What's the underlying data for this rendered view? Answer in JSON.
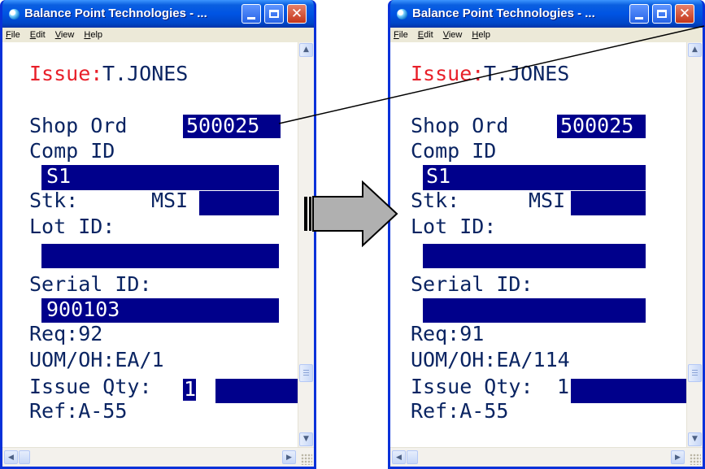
{
  "left": {
    "title": "Balance Point Technologies - ...",
    "menu": [
      "File",
      "Edit",
      "View",
      "Help"
    ],
    "screen": {
      "issue_label": "Issue:",
      "issue_user": "T.JONES",
      "shop_ord_label": "Shop Ord",
      "shop_ord_value": "500025",
      "comp_id_label": "Comp ID",
      "comp_id_value": "S1",
      "stk_label": "Stk:",
      "stk_value": "MSI",
      "lot_id_label": "Lot ID:",
      "lot_id_value": "",
      "serial_id_label": "Serial ID:",
      "serial_id_value": "900103",
      "req": "Req:92",
      "uom_oh": "UOM/OH:EA/1",
      "issue_qty_label": "Issue Qty:",
      "issue_qty_value": "1",
      "ref": "Ref:A-55"
    }
  },
  "right": {
    "title": "Balance Point Technologies - ...",
    "menu": [
      "File",
      "Edit",
      "View",
      "Help"
    ],
    "screen": {
      "issue_label": "Issue:",
      "issue_user": "T.JONES",
      "shop_ord_label": "Shop Ord",
      "shop_ord_value": "500025",
      "comp_id_label": "Comp ID",
      "comp_id_value": "S1",
      "stk_label": "Stk:",
      "stk_value": "MSI",
      "lot_id_label": "Lot ID:",
      "lot_id_value": "",
      "serial_id_label": "Serial ID:",
      "serial_id_value": "",
      "req": "Req:91",
      "uom_oh": "UOM/OH:EA/114",
      "issue_qty_label": "Issue Qty:",
      "issue_qty_value": "1",
      "ref": "Ref:A-55"
    }
  },
  "colors": {
    "titlebar": "#0054e3",
    "field_highlight": "#00008b",
    "terminal_text": "#0a2462",
    "issue_label": "#e8202a",
    "arrow_fill": "#b0b0b0"
  }
}
